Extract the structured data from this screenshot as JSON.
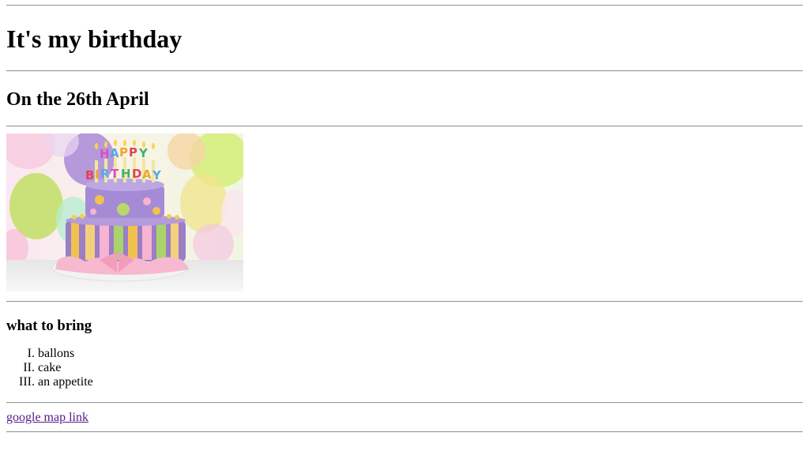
{
  "heading": "It's my birthday",
  "subheading": "On the 26th April",
  "image": {
    "icon": "birthday-cake-image",
    "cake_topper": "HAPPY BIRTHDAY"
  },
  "bring": {
    "title": "what to bring",
    "items": [
      "ballons",
      "cake",
      "an appetite"
    ]
  },
  "link": {
    "label": "google map link"
  },
  "colors": {
    "link_visited": "#551a8b",
    "rule": "#9a9a9a"
  }
}
